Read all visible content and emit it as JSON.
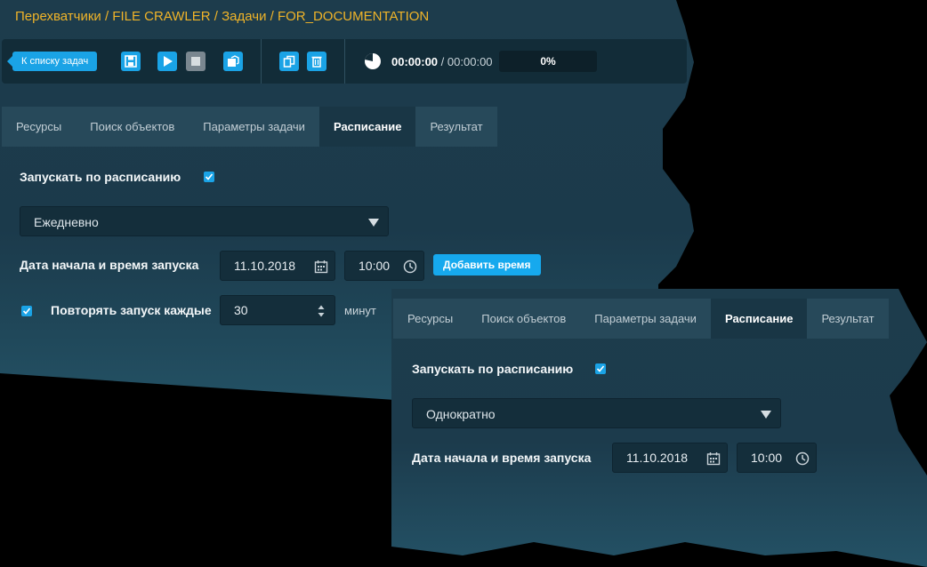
{
  "breadcrumb": "Перехватчики / FILE CRAWLER / Задачи / FOR_DOCUMENTATION",
  "toolbar": {
    "back_label": "К списку задач",
    "buttons": [
      "save-icon",
      "play-icon",
      "stop-icon",
      "export-icon",
      "copy-icon",
      "delete-icon"
    ],
    "timer_current": "00:00:00",
    "timer_separator": "/",
    "timer_total": "00:00:00",
    "progress": "0%",
    "accent_color": "#1aa3e6"
  },
  "main": {
    "tabs": [
      "Ресурсы",
      "Поиск объектов",
      "Параметры задачи",
      "Расписание",
      "Результат"
    ],
    "active_tab": "Расписание",
    "schedule_label": "Запускать по расписанию",
    "schedule_checked": true,
    "frequency": "Ежедневно",
    "start_label": "Дата начала и время запуска",
    "start_date": "11.10.2018",
    "start_time": "10:00",
    "add_time_label": "Добавить время",
    "repeat_checked": true,
    "repeat_label": "Повторять запуск каждые",
    "repeat_value": "30",
    "repeat_unit": "минут"
  },
  "second": {
    "tabs": [
      "Ресурсы",
      "Поиск объектов",
      "Параметры задачи",
      "Расписание",
      "Результат"
    ],
    "active_tab": "Расписание",
    "schedule_label": "Запускать по расписанию",
    "schedule_checked": true,
    "frequency": "Однократно",
    "start_label": "Дата начала и время запуска",
    "start_date": "11.10.2018",
    "start_time": "10:00"
  }
}
